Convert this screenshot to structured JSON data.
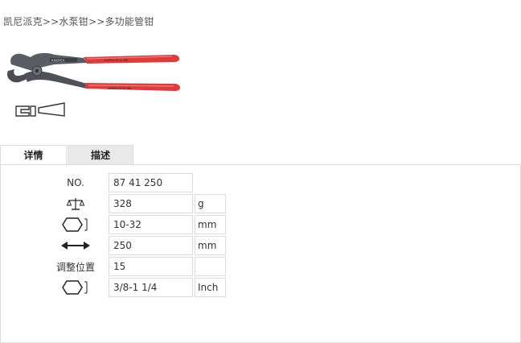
{
  "breadcrumb": {
    "items": [
      "凯尼派克",
      "水泵钳",
      "多功能管钳"
    ],
    "separator": ">>"
  },
  "product": {
    "image_icon": "pliers-image",
    "brand_imprint": "KNIPEX",
    "handle_color": "#e03b3b"
  },
  "tabs": [
    {
      "label": "详情",
      "active": true
    },
    {
      "label": "描述",
      "active": false
    }
  ],
  "specs": {
    "no_label": "NO.",
    "no_value": "87 41 250",
    "weight": {
      "icon": "scale-icon",
      "value": "328",
      "unit": "g"
    },
    "capacity": {
      "icon": "hex-nut-icon",
      "value": "10-32",
      "unit": "mm"
    },
    "length": {
      "icon": "double-arrow-icon",
      "value": "250",
      "unit": "mm"
    },
    "adjust": {
      "label": "调整位置",
      "value": "15",
      "unit": ""
    },
    "pipe": {
      "icon": "hex-nut-icon",
      "value": "3/8-1 1/4",
      "unit": "Inch"
    }
  },
  "colors": {
    "border": "#dcdcdc",
    "tab_inactive": "#e9e9e9"
  }
}
